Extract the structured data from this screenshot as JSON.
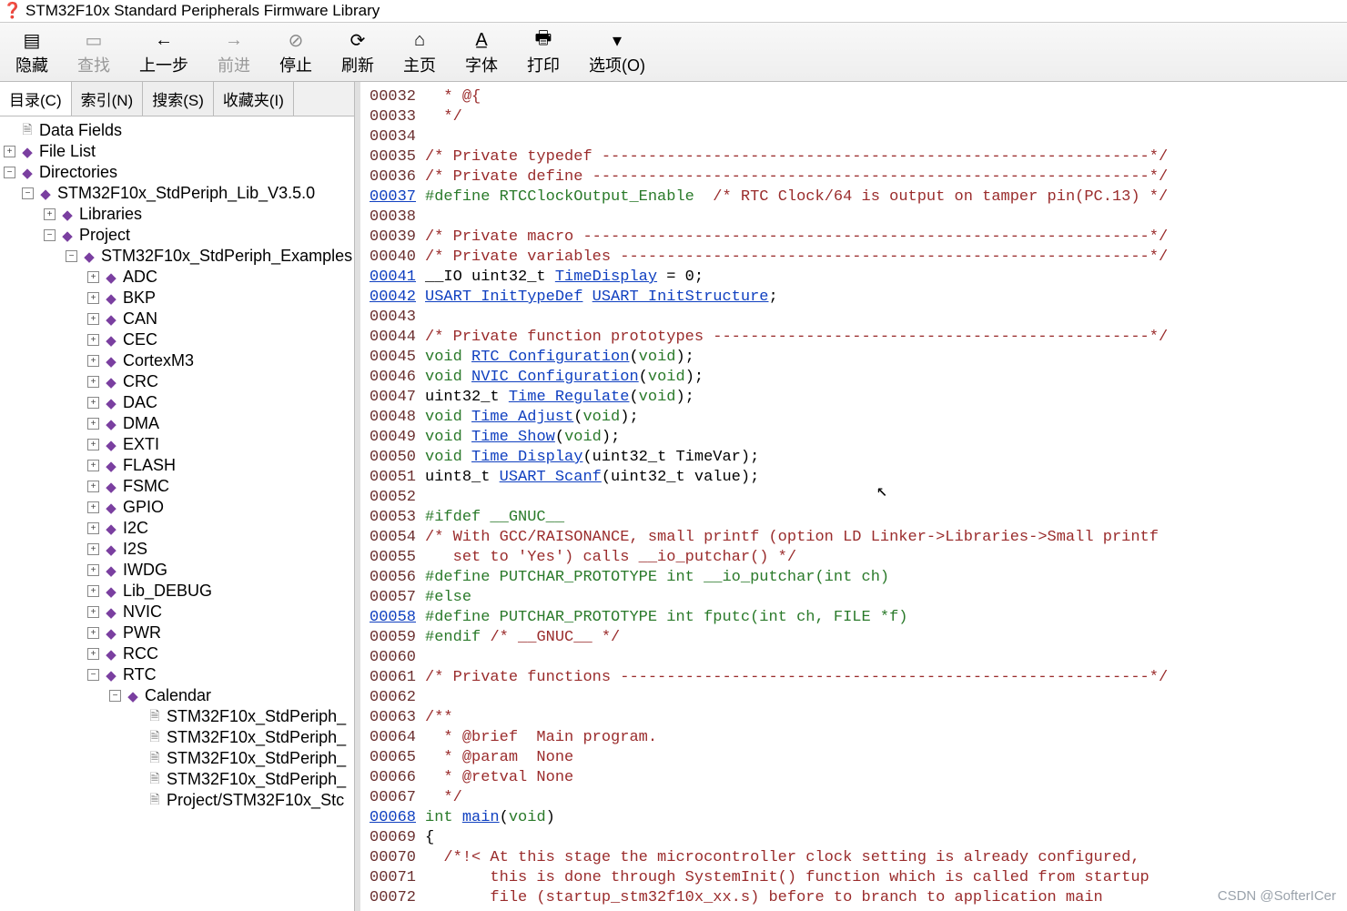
{
  "title": "STM32F10x Standard Peripherals Firmware Library",
  "toolbar": {
    "hide": "隐藏",
    "find": "查找",
    "back": "上一步",
    "forward": "前进",
    "stop": "停止",
    "refresh": "刷新",
    "home": "主页",
    "font": "字体",
    "print": "打印",
    "options": "选项(O)"
  },
  "sidetabs": {
    "contents": "目录(C)",
    "index": "索引(N)",
    "search": "搜索(S)",
    "favorites": "收藏夹(I)"
  },
  "tree": {
    "datafields": "Data Fields",
    "filelist": "File List",
    "directories": "Directories",
    "lib": "STM32F10x_StdPeriph_Lib_V3.5.0",
    "libraries": "Libraries",
    "project": "Project",
    "examples": "STM32F10x_StdPeriph_Examples",
    "adc": "ADC",
    "bkp": "BKP",
    "can": "CAN",
    "cec": "CEC",
    "cortexm3": "CortexM3",
    "crc": "CRC",
    "dac": "DAC",
    "dma": "DMA",
    "exti": "EXTI",
    "flash": "FLASH",
    "fsmc": "FSMC",
    "gpio": "GPIO",
    "i2c": "I2C",
    "i2s": "I2S",
    "iwdg": "IWDG",
    "lib_debug": "Lib_DEBUG",
    "nvic": "NVIC",
    "pwr": "PWR",
    "rcc": "RCC",
    "rtc": "RTC",
    "calendar": "Calendar",
    "f1": "STM32F10x_StdPeriph_",
    "f2": "STM32F10x_StdPeriph_",
    "f3": "STM32F10x_StdPeriph_",
    "f4": "STM32F10x_StdPeriph_",
    "f5": "Project/STM32F10x_Stc"
  },
  "code": {
    "links": {
      "l37": "00037",
      "l41": "00041",
      "l42": "00042",
      "l58": "00058",
      "l68": "00068",
      "TimeDisplay": "TimeDisplay",
      "USART_InitTypeDef": "USART_InitTypeDef",
      "USART_InitStructure": "USART_InitStructure",
      "RTC_Configuration": "RTC_Configuration",
      "NVIC_Configuration": "NVIC_Configuration",
      "Time_Regulate": "Time_Regulate",
      "Time_Adjust": "Time_Adjust",
      "Time_Show": "Time_Show",
      "Time_Display": "Time_Display",
      "USART_Scanf": "USART_Scanf",
      "main": "main"
    },
    "lines": [
      {
        "n": "00032",
        "html": "<span class='cm'>  * @{</span>"
      },
      {
        "n": "00033",
        "html": "<span class='cm'>  */</span>"
      },
      {
        "n": "00034",
        "html": ""
      },
      {
        "n": "00035",
        "html": "<span class='cm'>/* Private typedef -----------------------------------------------------------*/</span>"
      },
      {
        "n": "00036",
        "html": "<span class='cm'>/* Private define ------------------------------------------------------------*/</span>"
      },
      {
        "n": "00037",
        "link": true,
        "html": "<span class='pp'>#define RTCClockOutput_Enable  </span><span class='cm'>/* RTC Clock/64 is output on tamper pin(PC.13) */</span>"
      },
      {
        "n": "00038",
        "html": ""
      },
      {
        "n": "00039",
        "html": "<span class='cm'>/* Private macro -------------------------------------------------------------*/</span>"
      },
      {
        "n": "00040",
        "html": "<span class='cm'>/* Private variables ---------------------------------------------------------*/</span>"
      },
      {
        "n": "00041",
        "link": true,
        "html": "__IO uint32_t <span class='idlink' data-name='id-timedisplay' data-interactable='true'>TimeDisplay</span> = 0;"
      },
      {
        "n": "00042",
        "link": true,
        "html": "<span class='idlink' data-name='id-usart-inittypedef' data-interactable='true'>USART_InitTypeDef</span> <span class='idlink' data-name='id-usart-initstructure' data-interactable='true'>USART_InitStructure</span>;"
      },
      {
        "n": "00043",
        "html": ""
      },
      {
        "n": "00044",
        "html": "<span class='cm'>/* Private function prototypes -----------------------------------------------*/</span>"
      },
      {
        "n": "00045",
        "html": "<span class='kw'>void</span> <span class='idlink' data-name='id-rtc-configuration' data-interactable='true'>RTC_Configuration</span>(<span class='kw'>void</span>);"
      },
      {
        "n": "00046",
        "html": "<span class='kw'>void</span> <span class='idlink' data-name='id-nvic-configuration' data-interactable='true'>NVIC_Configuration</span>(<span class='kw'>void</span>);"
      },
      {
        "n": "00047",
        "html": "uint32_t <span class='idlink' data-name='id-time-regulate' data-interactable='true'>Time_Regulate</span>(<span class='kw'>void</span>);"
      },
      {
        "n": "00048",
        "html": "<span class='kw'>void</span> <span class='idlink' data-name='id-time-adjust' data-interactable='true'>Time_Adjust</span>(<span class='kw'>void</span>);"
      },
      {
        "n": "00049",
        "html": "<span class='kw'>void</span> <span class='idlink' data-name='id-time-show' data-interactable='true'>Time_Show</span>(<span class='kw'>void</span>);"
      },
      {
        "n": "00050",
        "html": "<span class='kw'>void</span> <span class='idlink' data-name='id-time-display' data-interactable='true'>Time_Display</span>(uint32_t TimeVar);"
      },
      {
        "n": "00051",
        "html": "uint8_t <span class='idlink' data-name='id-usart-scanf' data-interactable='true'>USART_Scanf</span>(uint32_t value);"
      },
      {
        "n": "00052",
        "html": ""
      },
      {
        "n": "00053",
        "html": "<span class='pp'>#ifdef __GNUC__</span>"
      },
      {
        "n": "00054",
        "html": "<span class='cm'>/* With GCC/RAISONANCE, small printf (option LD Linker->Libraries->Small printf</span>"
      },
      {
        "n": "00055",
        "html": "<span class='cm'>   set to 'Yes') calls __io_putchar() */</span>"
      },
      {
        "n": "00056",
        "html": "<span class='pp'>#define PUTCHAR_PROTOTYPE int __io_putchar(int ch)</span>"
      },
      {
        "n": "00057",
        "html": "<span class='pp'>#else</span>"
      },
      {
        "n": "00058",
        "link": true,
        "html": "<span class='pp'>#define PUTCHAR_PROTOTYPE int fputc(int ch, FILE *f)</span>"
      },
      {
        "n": "00059",
        "html": "<span class='pp'>#endif </span><span class='cm'>/* __GNUC__ */</span>"
      },
      {
        "n": "00060",
        "html": ""
      },
      {
        "n": "00061",
        "html": "<span class='cm'>/* Private functions ---------------------------------------------------------*/</span>"
      },
      {
        "n": "00062",
        "html": ""
      },
      {
        "n": "00063",
        "html": "<span class='cm'>/**</span>"
      },
      {
        "n": "00064",
        "html": "<span class='cm'>  * @brief  Main program.</span>"
      },
      {
        "n": "00065",
        "html": "<span class='cm'>  * @param  None</span>"
      },
      {
        "n": "00066",
        "html": "<span class='cm'>  * @retval None</span>"
      },
      {
        "n": "00067",
        "html": "<span class='cm'>  */</span>"
      },
      {
        "n": "00068",
        "link": true,
        "html": "<span class='kw'>int</span> <span class='idlink' data-name='id-main' data-interactable='true'>main</span>(<span class='kw'>void</span>)"
      },
      {
        "n": "00069",
        "html": "{"
      },
      {
        "n": "00070",
        "html": "<span class='cm'>  /*!&lt; At this stage the microcontroller clock setting is already configured,</span>"
      },
      {
        "n": "00071",
        "html": "<span class='cm'>       this is done through SystemInit() function which is called from startup</span>"
      },
      {
        "n": "00072",
        "html": "<span class='cm'>       file (startup_stm32f10x_xx.s) before to branch to application main</span>"
      }
    ]
  },
  "watermark": "CSDN @SofterICer"
}
